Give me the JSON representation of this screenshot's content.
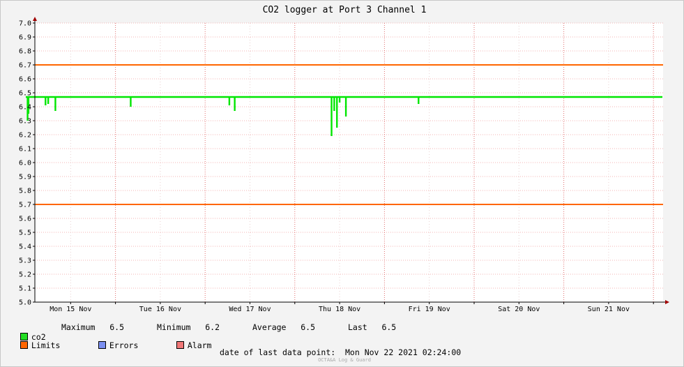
{
  "chart_data": {
    "type": "line",
    "title": "CO2 logger at Port 3 Channel 1",
    "ylim": [
      5.0,
      7.0
    ],
    "yticks": [
      "5.0",
      "5.1",
      "5.2",
      "5.3",
      "5.4",
      "5.5",
      "5.6",
      "5.7",
      "5.8",
      "5.9",
      "6.0",
      "6.1",
      "6.2",
      "6.3",
      "6.4",
      "6.5",
      "6.6",
      "6.7",
      "6.8",
      "6.9",
      "7.0"
    ],
    "x_range_days": [
      0,
      7.1
    ],
    "x_tick_labels": [
      "Mon 15 Nov",
      "Tue 16 Nov",
      "Wed 17 Nov",
      "Thu 18 Nov",
      "Fri 19 Nov",
      "Sat 20 Nov",
      "Sun 21 Nov"
    ],
    "grid": true,
    "limits": [
      5.7,
      6.7
    ],
    "series": [
      {
        "name": "co2",
        "color": "#00e600",
        "baseline": 6.47,
        "dips": [
          {
            "x": 0.02,
            "y": 6.3
          },
          {
            "x": 0.03,
            "y": 6.35
          },
          {
            "x": 0.22,
            "y": 6.41
          },
          {
            "x": 0.25,
            "y": 6.42
          },
          {
            "x": 0.33,
            "y": 6.37
          },
          {
            "x": 1.17,
            "y": 6.4
          },
          {
            "x": 2.27,
            "y": 6.41
          },
          {
            "x": 2.33,
            "y": 6.37
          },
          {
            "x": 3.41,
            "y": 6.19
          },
          {
            "x": 3.44,
            "y": 6.37
          },
          {
            "x": 3.47,
            "y": 6.25
          },
          {
            "x": 3.5,
            "y": 6.43
          },
          {
            "x": 3.57,
            "y": 6.33
          },
          {
            "x": 4.38,
            "y": 6.42
          }
        ]
      }
    ]
  },
  "legend": {
    "co2_label": "co2",
    "maximum": "Maximum   6.5",
    "minimum": "Minimum   6.2",
    "average": "Average   6.5",
    "last": "Last   6.5",
    "limits_label": "Limits",
    "errors_label": "Errors",
    "alarm_label": "Alarm",
    "colors": {
      "co2": "#22dd22",
      "limits": "#ff6600",
      "errors": "#7b8ff0",
      "alarm": "#f07777"
    }
  },
  "footer": {
    "last_point": "date of last data point:  Mon Nov 22 2021 02:24:00",
    "credit": "OCTA&A Log & Guard"
  }
}
